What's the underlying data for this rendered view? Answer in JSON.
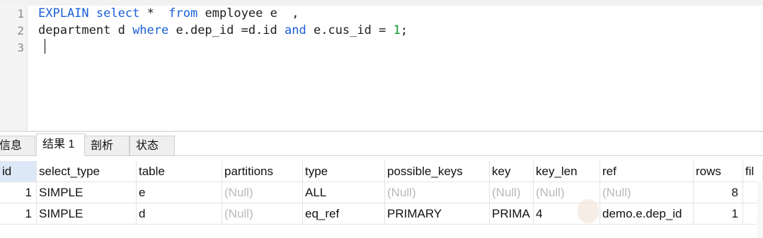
{
  "editor": {
    "line_numbers": [
      "1",
      "2",
      "3"
    ],
    "line1": {
      "kw_explain": "EXPLAIN",
      "kw_select": "select",
      "part_star": " * ",
      "kw_from": "from",
      "part_rest": " employee e  ,"
    },
    "line2": {
      "part_dept": "department d ",
      "kw_where": "where",
      "part_cond1": " e.dep_id =d.id ",
      "kw_and": "and",
      "part_cond2": " e.cus_id = ",
      "num_value": "1",
      "part_end": ";"
    }
  },
  "tabs": [
    {
      "label": "信息"
    },
    {
      "label": "结果 1"
    },
    {
      "label": "剖析"
    },
    {
      "label": "状态"
    }
  ],
  "table": {
    "columns": [
      "id",
      "select_type",
      "table",
      "partitions",
      "type",
      "possible_keys",
      "key",
      "key_len",
      "ref",
      "rows",
      "fil"
    ],
    "rows": [
      [
        "1",
        "SIMPLE",
        "e",
        "(Null)",
        "ALL",
        "(Null)",
        "(Null)",
        "(Null)",
        "(Null)",
        "8",
        ""
      ],
      [
        "1",
        "SIMPLE",
        "d",
        "(Null)",
        "eq_ref",
        "PRIMARY",
        "PRIMA",
        "4",
        "demo.e.dep_id",
        "1",
        ""
      ]
    ]
  }
}
